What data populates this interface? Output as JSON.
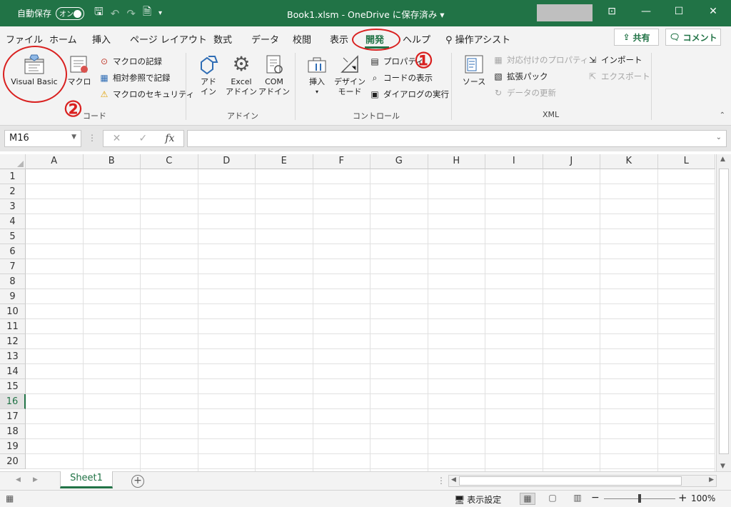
{
  "titlebar": {
    "autosave_label": "自動保存",
    "autosave_state": "オン",
    "title": "Book1.xlsm  -  OneDrive に保存済み  ▾",
    "accent": "#217346"
  },
  "tabs": [
    "ファイル",
    "ホーム",
    "挿入",
    "ページ レイアウト",
    "数式",
    "データ",
    "校閲",
    "表示",
    "開発",
    "ヘルプ",
    "操作アシスト"
  ],
  "active_tab": "開発",
  "share_label": "共有",
  "comment_label": "コメント",
  "ribbon": {
    "code": {
      "label": "コード",
      "visual_basic": "Visual Basic",
      "macro": "マクロ",
      "record_macro": "マクロの記録",
      "relative_ref": "相対参照で記録",
      "macro_security": "マクロのセキュリティ"
    },
    "addins": {
      "label": "アドイン",
      "addin_line1": "アド",
      "addin_line2": "イン",
      "excel_line1": "Excel",
      "excel_line2": "アドイン",
      "com_line1": "COM",
      "com_line2": "アドイン"
    },
    "controls": {
      "label": "コントロール",
      "insert": "挿入",
      "design_line1": "デザイン",
      "design_line2": "モード",
      "properties": "プロパティ",
      "view_code": "コードの表示",
      "run_dialog": "ダイアログの実行"
    },
    "xml": {
      "label": "XML",
      "source": "ソース",
      "map_properties": "対応付けのプロパティ",
      "expansion_packs": "拡張パック",
      "refresh_data": "データの更新",
      "import": "インポート",
      "export": "エクスポート"
    }
  },
  "annotations": {
    "one": "①",
    "two": "②",
    "color": "#d9201f"
  },
  "formula_bar": {
    "name_box": "M16",
    "fx": "fx",
    "value": ""
  },
  "columns": [
    "A",
    "B",
    "C",
    "D",
    "E",
    "F",
    "G",
    "H",
    "I",
    "J",
    "K",
    "L"
  ],
  "rows": [
    "1",
    "2",
    "3",
    "4",
    "5",
    "6",
    "7",
    "8",
    "9",
    "10",
    "11",
    "12",
    "13",
    "14",
    "15",
    "16",
    "17",
    "18",
    "19",
    "20"
  ],
  "selected_row": "16",
  "sheet_tab": "Sheet1",
  "status": {
    "display_settings": "表示設定",
    "zoom": "100%"
  }
}
